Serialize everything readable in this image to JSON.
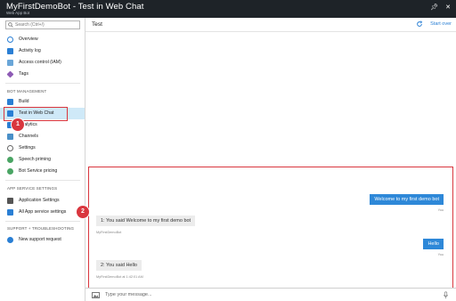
{
  "window": {
    "title": "MyFirstDemoBot - Test in Web Chat",
    "subtitle": "Web App Bot"
  },
  "sidebar": {
    "search_placeholder": "Search (Ctrl+/)",
    "top_items": [
      {
        "label": "Overview",
        "icon": "overview-icon"
      },
      {
        "label": "Activity log",
        "icon": "activity-log-icon"
      },
      {
        "label": "Access control (IAM)",
        "icon": "access-control-icon"
      },
      {
        "label": "Tags",
        "icon": "tag-icon"
      }
    ],
    "bot_management": {
      "heading": "BOT MANAGEMENT",
      "items": [
        {
          "label": "Build",
          "icon": "build-icon"
        },
        {
          "label": "Test in Web Chat",
          "icon": "test-web-chat-icon"
        },
        {
          "label": "Analytics",
          "icon": "analytics-icon"
        },
        {
          "label": "Channels",
          "icon": "channels-icon"
        },
        {
          "label": "Settings",
          "icon": "settings-icon"
        },
        {
          "label": "Speech priming",
          "icon": "speech-priming-icon"
        },
        {
          "label": "Bot Service pricing",
          "icon": "pricing-icon"
        }
      ]
    },
    "app_service_settings": {
      "heading": "APP SERVICE SETTINGS",
      "items": [
        {
          "label": "Application Settings",
          "icon": "app-settings-icon"
        },
        {
          "label": "All App service settings",
          "icon": "all-settings-icon"
        }
      ]
    },
    "support": {
      "heading": "SUPPORT + TROUBLESHOOTING",
      "items": [
        {
          "label": "New support request",
          "icon": "support-icon"
        }
      ]
    }
  },
  "callouts": {
    "one": "1",
    "two": "2"
  },
  "test_panel": {
    "title": "Test",
    "start_over_label": "Start over"
  },
  "chat": {
    "messages": [
      {
        "from": "user",
        "text": "Welcome to my first demo bot",
        "meta": "You"
      },
      {
        "from": "bot",
        "text": "1: You said Welcome to my first demo bot",
        "meta": "MyFirstDemoBot"
      },
      {
        "from": "user",
        "text": "Hello",
        "meta": "You"
      },
      {
        "from": "bot",
        "text": "2: You said Hello",
        "meta": "MyFirstDemoBot at 1:42:01 AM"
      }
    ],
    "input_placeholder": "Type your message..."
  },
  "colors": {
    "accent": "#2e88d8",
    "highlight": "#d9363e",
    "active_item": "#cfe9f8",
    "titlebar": "#1e2328"
  }
}
